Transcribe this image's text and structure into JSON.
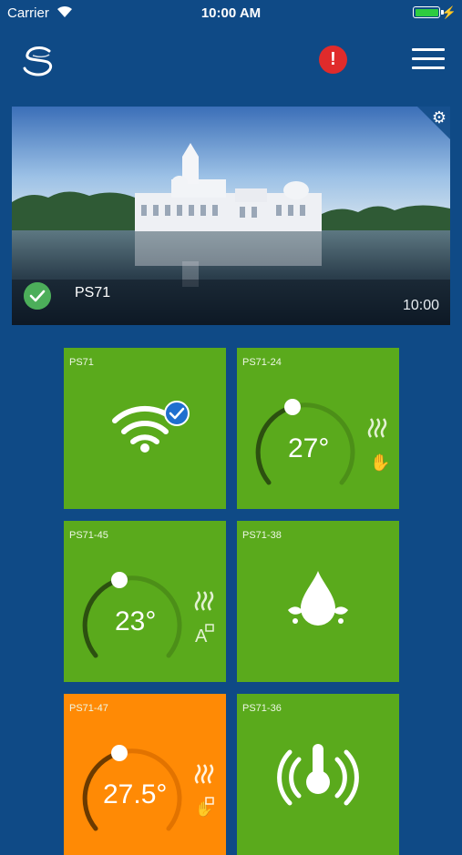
{
  "status_bar": {
    "carrier": "Carrier",
    "time": "10:00 AM"
  },
  "header": {
    "logo": "s-logo",
    "alert": "!",
    "menu": "hamburger-menu-icon"
  },
  "banner": {
    "name": "PS71",
    "time": "10:00",
    "settings_icon": "gear-icon",
    "status_icon": "check-icon"
  },
  "tiles": [
    {
      "label": "PS71",
      "type": "wifi",
      "icon": "wifi-connected-icon"
    },
    {
      "label": "PS71-24",
      "type": "thermostat",
      "temp": "27°",
      "mode_icons": [
        "heat-icon",
        "hand-icon"
      ],
      "level": 0.5
    },
    {
      "label": "PS71-45",
      "type": "thermostat",
      "temp": "23°",
      "mode_icons": [
        "heat-icon",
        "auto-icon"
      ],
      "level": 0.5
    },
    {
      "label": "PS71-38",
      "type": "water",
      "icon": "water-drop-icon"
    },
    {
      "label": "PS71-47",
      "type": "thermostat",
      "temp": "27.5°",
      "mode_icons": [
        "heat-icon",
        "hand-icon"
      ],
      "level": 0.5
    },
    {
      "label": "PS71-36",
      "type": "sensor",
      "icon": "thermometer-signal-icon"
    }
  ],
  "colors": {
    "background": "#0f4a86",
    "tile_green": "#5aaa1c",
    "tile_orange": "#ff8a05",
    "alert_red": "#e02b2b"
  }
}
